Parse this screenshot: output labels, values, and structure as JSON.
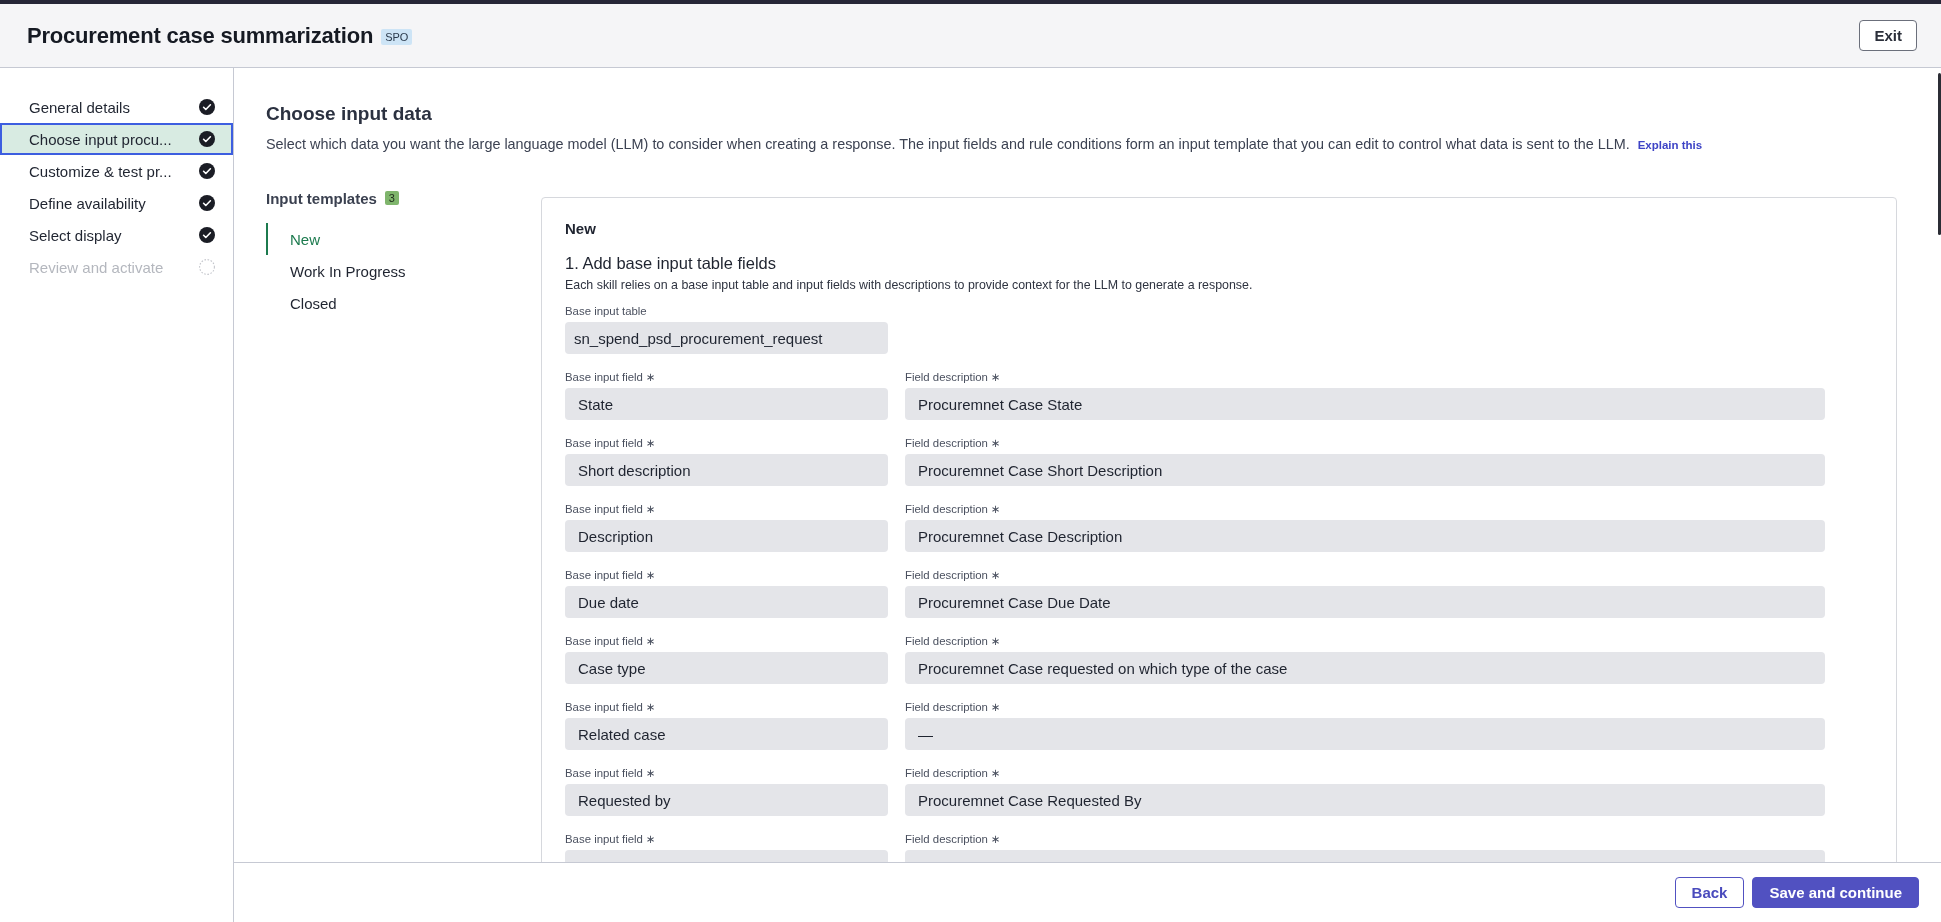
{
  "header": {
    "title": "Procurement case summarization",
    "tag": "SPO",
    "exit_button": "Exit"
  },
  "sidebar": {
    "steps": [
      {
        "label": "General details",
        "completed": true,
        "selected": false,
        "disabled": false
      },
      {
        "label": "Choose input procu...",
        "completed": true,
        "selected": true,
        "disabled": false
      },
      {
        "label": "Customize & test pr...",
        "completed": true,
        "selected": false,
        "disabled": false
      },
      {
        "label": "Define availability",
        "completed": true,
        "selected": false,
        "disabled": false
      },
      {
        "label": "Select display",
        "completed": true,
        "selected": false,
        "disabled": false
      },
      {
        "label": "Review and activate",
        "completed": false,
        "selected": false,
        "disabled": true
      }
    ]
  },
  "main": {
    "heading": "Choose input data",
    "description": "Select which data you want the large language model (LLM) to consider when creating a response. The input fields and rule conditions form an input template that you can edit to control what data is sent to the LLM.",
    "explain_link": "Explain this",
    "templates": {
      "title": "Input templates",
      "count": "3",
      "items": [
        {
          "label": "New",
          "selected": true
        },
        {
          "label": "Work In Progress",
          "selected": false
        },
        {
          "label": "Closed",
          "selected": false
        }
      ]
    },
    "card": {
      "title": "New",
      "section_title": "1. Add base input table fields",
      "section_hint": "Each skill relies on a base input table and input fields with descriptions to provide context for the LLM to generate a response.",
      "base_table": {
        "label": "Base input table",
        "value": "sn_spend_psd_procurement_request"
      },
      "fields": [
        {
          "field_label": "Base input field ∗",
          "field_value": "State",
          "description_label": "Field description ∗",
          "description_value": "Procuremnet Case State"
        },
        {
          "field_label": "Base input field ∗",
          "field_value": "Short description",
          "description_label": "Field description ∗",
          "description_value": "Procuremnet Case Short Description"
        },
        {
          "field_label": "Base input field ∗",
          "field_value": "Description",
          "description_label": "Field description ∗",
          "description_value": "Procuremnet Case Description"
        },
        {
          "field_label": "Base input field ∗",
          "field_value": "Due date",
          "description_label": "Field description ∗",
          "description_value": "Procuremnet Case Due Date"
        },
        {
          "field_label": "Base input field ∗",
          "field_value": "Case type",
          "description_label": "Field description ∗",
          "description_value": "Procuremnet Case requested on which type of the case"
        },
        {
          "field_label": "Base input field ∗",
          "field_value": "Related case",
          "description_label": "Field description ∗",
          "description_value": "—"
        },
        {
          "field_label": "Base input field ∗",
          "field_value": "Requested by",
          "description_label": "Field description ∗",
          "description_value": "Procuremnet Case Requested By"
        },
        {
          "field_label": "Base input field ∗",
          "description_label": "Field description ∗"
        }
      ]
    }
  },
  "footer": {
    "buttons": [
      {
        "label": "Back",
        "kind": "secondary"
      },
      {
        "label": "Save and continue",
        "kind": "primary"
      }
    ]
  }
}
